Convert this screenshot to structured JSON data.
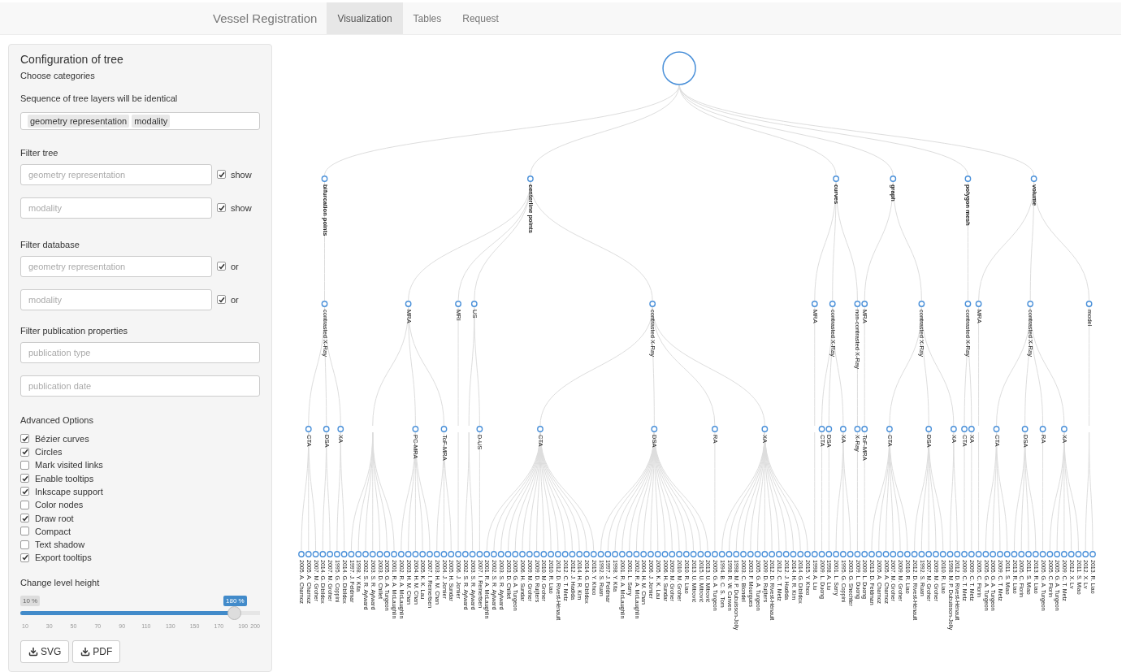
{
  "navbar": {
    "brand": "Vessel Registration",
    "tabs": [
      {
        "label": "Visualization",
        "selected": true
      },
      {
        "label": "Tables",
        "selected": false
      },
      {
        "label": "Request",
        "selected": false
      }
    ]
  },
  "sidebar": {
    "title": "Configuration of tree",
    "choose_label": "Choose categories",
    "sequence_label": "Sequence of tree layers will be identical",
    "sequence_tags": [
      "geometry representation",
      "modality"
    ],
    "filter_tree": {
      "label": "Filter tree",
      "rows": [
        {
          "placeholder": "geometry representation",
          "checked": true,
          "option": "show"
        },
        {
          "placeholder": "modality",
          "checked": true,
          "option": "show"
        }
      ]
    },
    "filter_database": {
      "label": "Filter database",
      "rows": [
        {
          "placeholder": "geometry representation",
          "checked": true,
          "option": "or"
        },
        {
          "placeholder": "modality",
          "checked": true,
          "option": "or"
        }
      ]
    },
    "filter_publication": {
      "label": "Filter publication properties",
      "fields": [
        {
          "placeholder": "publication type"
        },
        {
          "placeholder": "publication date"
        }
      ]
    },
    "advanced": {
      "label": "Advanced Options",
      "options": [
        {
          "label": "Bézier curves",
          "checked": true
        },
        {
          "label": "Circles",
          "checked": true
        },
        {
          "label": "Mark visited links",
          "checked": false
        },
        {
          "label": "Enable tooltips",
          "checked": true
        },
        {
          "label": "Inkscape support",
          "checked": true
        },
        {
          "label": "Color nodes",
          "checked": false
        },
        {
          "label": "Draw root",
          "checked": true
        },
        {
          "label": "Compact",
          "checked": false
        },
        {
          "label": "Text shadow",
          "checked": false
        },
        {
          "label": "Export tooltips",
          "checked": true
        }
      ]
    },
    "level_height": {
      "label": "Change level height",
      "min_label": "10 %",
      "value_label": "180 %",
      "level": 0.895,
      "ticks": [
        "10",
        "30",
        "50",
        "70",
        "90",
        "110",
        "130",
        "150",
        "170",
        "190",
        "200"
      ]
    },
    "buttons": [
      "SVG",
      "PDF"
    ]
  },
  "tree": {
    "children": [
      {
        "label": "bifurcation points",
        "children": [
          {
            "label": "contrasted X-Ray",
            "children": [
              {
                "label": "CTA",
                "children": [
                  {
                    "label": "2005. A. Charnoz"
                  },
                  {
                    "label": "2005. A. Charnoz"
                  },
                  {
                    "label": "2007. M. Groher"
                  }
                ]
              },
              {
                "label": "DSA",
                "children": [
                  {
                    "label": "2014. G. Dibildox"
                  },
                  {
                    "label": "2007. M. Groher"
                  }
                ]
              },
              {
                "label": "XA",
                "children": [
                  {
                    "label": "1995. G. Coppini"
                  },
                  {
                    "label": "2014. G. Dibildox"
                  }
                ]
              }
            ]
          }
        ]
      },
      {
        "label": "centerline points",
        "children": [
          {
            "label": "MRA",
            "children": [
              {
                "children": [
                  {
                    "label": "1997. J. Feldmar"
                  },
                  {
                    "label": "1998. Y. Kita"
                  },
                  {
                    "label": "2002. S. R. Aylward"
                  },
                  {
                    "label": "2003. S. R. Aylward"
                  },
                  {
                    "label": "2003. D. Chillet"
                  },
                  {
                    "label": "2005. G. A. Turgeon"
                  },
                  {
                    "label": "2001. R. A. McLaughlin"
                  }
                ]
              },
              {
                "label": "PC-MRA",
                "children": [
                  {
                    "label": "2002. R. A. McLaughlin"
                  },
                  {
                    "label": "2003. H. M. Chan"
                  },
                  {
                    "label": "2004. H. M. Chan"
                  },
                  {
                    "label": "2005. K. K. Lau"
                  },
                  {
                    "label": "2007. I. Reinertsen"
                  }
                ]
              },
              {
                "label": "ToF-MRA",
                "children": [
                  {
                    "label": "2003. H. M. Chan"
                  },
                  {
                    "label": "2004. J. Jomier"
                  },
                  {
                    "label": "2005. H. Sundar"
                  }
                ]
              }
            ]
          },
          {
            "label": "MRI",
            "children": [
              {
                "children": [
                  {
                    "label": "2006. J. Jomier"
                  }
                ]
              }
            ]
          },
          {
            "label": "US",
            "children": [
              {
                "children": [
                  {
                    "label": "2002. S. R. Aylward"
                  },
                  {
                    "label": "2003. S. R. Aylward"
                  }
                ]
              },
              {
                "label": "D-US",
                "children": [
                  {
                    "label": "2007. I. Reinertsen"
                  }
                ]
              }
            ]
          },
          {
            "label": "contrasted X-Ray",
            "children": [
              {
                "label": "CTA",
                "children": [
                  {
                    "label": "2001. R. A. McLaughlin"
                  },
                  {
                    "label": "2002. S. R. Aylward"
                  },
                  {
                    "label": "2003. S. R. Aylward"
                  },
                  {
                    "label": "2003. D. Chillet"
                  },
                  {
                    "label": "2005. G. A. Turgeon"
                  },
                  {
                    "label": "2006. H. Sundar"
                  },
                  {
                    "label": "2009. M. Groher"
                  },
                  {
                    "label": "2009. D. Ruijters"
                  },
                  {
                    "label": "2010. M. Groher"
                  },
                  {
                    "label": "2010. R. Liao"
                  },
                  {
                    "label": "2012. D. Rivest-Hénault"
                  },
                  {
                    "label": "2012. C. T. Metz"
                  },
                  {
                    "label": "2012. J. Hadida"
                  },
                  {
                    "label": "2014. H. R. Kim"
                  },
                  {
                    "label": "2014. G. Dibildox"
                  },
                  {
                    "label": "2015. Y. Khoo"
                  }
                ]
              },
              {
                "label": "DSA",
                "children": [
                  {
                    "label": "1992. S. Ruan"
                  },
                  {
                    "label": "1997. J. Feldmar"
                  },
                  {
                    "label": "1998. Y. Kita"
                  },
                  {
                    "label": "2001. R. A. McLaughlin"
                  },
                  {
                    "label": "2001. L. Sarry"
                  },
                  {
                    "label": "2002. R. A. McLaughlin"
                  },
                  {
                    "label": "2004. H. M. Chan"
                  },
                  {
                    "label": "2006. J. Jomier"
                  },
                  {
                    "label": "2005. K. K. Lau"
                  },
                  {
                    "label": "2006. H. Sundar"
                  },
                  {
                    "label": "2009. M. Groher"
                  },
                  {
                    "label": "2010. M. Groher"
                  },
                  {
                    "label": "2010. R. Liao"
                  },
                  {
                    "label": "2013. U. Mitrović"
                  },
                  {
                    "label": "2015. U. Mitrović"
                  },
                  {
                    "label": "2013. U. Mitrović"
                  }
                ]
              },
              {
                "label": "RA",
                "children": [
                  {
                    "label": "2005. G. A. Turgeon"
                  }
                ]
              },
              {
                "label": "XA",
                "children": [
                  {
                    "label": "1994. B. C. S. Tom"
                  },
                  {
                    "label": "1998. R. W. Curwen"
                  },
                  {
                    "label": "1998. M. P. Dubuisson-Jolly"
                  },
                  {
                    "label": "2003. C. Blondel"
                  },
                  {
                    "label": "2003. F. Mourgues"
                  },
                  {
                    "label": "2005. G. A. Turgeon"
                  },
                  {
                    "label": "2009. D. Ruijters"
                  },
                  {
                    "label": "2012. D. Rivest-Hénault"
                  },
                  {
                    "label": "2012. C. T. Metz"
                  },
                  {
                    "label": "2012. J. Hadida"
                  },
                  {
                    "label": "2014. H. R. Kim"
                  },
                  {
                    "label": "2014. G. Dibildox"
                  },
                  {
                    "label": "2015. Y. Khoo"
                  }
                ]
              }
            ]
          }
        ]
      },
      {
        "label": "curves",
        "children": [
          {
            "label": "MRA",
            "children": [
              {
                "children": [
                  {
                    "label": "1998. A. Liu"
                  }
                ]
              }
            ]
          },
          {
            "label": "contrasted X-Ray",
            "children": [
              {
                "label": "CTA",
                "children": [
                  {
                    "label": "2009. L. Duong"
                  }
                ]
              },
              {
                "label": "DSA",
                "children": [
                  {
                    "label": "1998. A. Liu"
                  }
                ]
              },
              {
                "label": "XA",
                "children": [
                  {
                    "label": "2001. L. Sarry"
                  },
                  {
                    "label": "1995. G. Coppini"
                  },
                  {
                    "label": "2003. G. Shechter"
                  }
                ]
              }
            ]
          },
          {
            "label": "non-contrasted X-Ray",
            "children": [
              {
                "label": "X-Ray",
                "children": [
                  {
                    "label": "2009. L. Duong"
                  }
                ]
              }
            ]
          }
        ]
      },
      {
        "label": "graph",
        "children": [
          {
            "label": "MRA",
            "children": [
              {
                "label": "ToF-MRA",
                "children": [
                  {
                    "label": "2009. L. Duong"
                  }
                ]
              }
            ]
          },
          {
            "label": "contrasted X-Ray",
            "children": [
              {
                "label": "CTA",
                "children": [
                  {
                    "label": "2013. D. Feldman"
                  },
                  {
                    "label": "2005. A. Charnoz"
                  },
                  {
                    "label": "2005. A. Charnoz"
                  },
                  {
                    "label": "2007. M. Groher"
                  },
                  {
                    "label": "2009. M. Groher"
                  },
                  {
                    "label": "2010. R. Liao"
                  }
                ]
              },
              {
                "label": "DSA",
                "children": [
                  {
                    "label": "2012. D. Rivest-Hénault"
                  },
                  {
                    "label": "1992. S. Ruan"
                  },
                  {
                    "label": "2007. M. Groher"
                  },
                  {
                    "label": "2009. M. Groher"
                  },
                  {
                    "label": "2010. R. Liao"
                  }
                ]
              },
              {
                "label": "XA",
                "children": [
                  {
                    "label": "1998. M. P. Dubuisson-Jolly"
                  },
                  {
                    "label": "2012. D. Rivest-Hénault"
                  }
                ]
              }
            ]
          }
        ]
      },
      {
        "label": "polygon mesh",
        "children": [
          {
            "label": "contrasted X-Ray",
            "children": [
              {
                "label": "CTA",
                "children": [
                  {
                    "label": "2009. C. T. Metz"
                  }
                ]
              },
              {
                "label": "XA",
                "children": [
                  {
                    "label": "2009. C. T. Metz"
                  }
                ]
              }
            ]
          }
        ]
      },
      {
        "label": "volume",
        "children": [
          {
            "label": "MRA",
            "children": [
              {
                "children": [
                  {
                    "label": "2005. C. Florin"
                  }
                ]
              }
            ]
          },
          {
            "label": "contrasted X-Ray",
            "children": [
              {
                "label": "CTA",
                "children": [
                  {
                    "label": "2005. G. A. Turgeon"
                  },
                  {
                    "label": "2005. G. A. Turgeon"
                  },
                  {
                    "label": "2009. C. T. Metz"
                  },
                  {
                    "label": "2011. S. Miao"
                  }
                ]
              },
              {
                "label": "DSA",
                "children": [
                  {
                    "label": "2013. R. Liao"
                  },
                  {
                    "label": "2005. C. Florin"
                  },
                  {
                    "label": "2011. S. Miao"
                  },
                  {
                    "label": "2013. R. Liao"
                  }
                ]
              },
              {
                "label": "RA",
                "children": [
                  {
                    "label": "2005. G. A. Turgeon"
                  }
                ]
              },
              {
                "label": "XA",
                "children": [
                  {
                    "label": "2005. C. Florin"
                  },
                  {
                    "label": "2005. G. A. Turgeon"
                  },
                  {
                    "label": "2009. C. T. Metz"
                  },
                  {
                    "label": "2012. X. Lv"
                  },
                  {
                    "label": "2011. S. Miao"
                  }
                ]
              }
            ]
          },
          {
            "label": "model",
            "children": [
              {
                "children": [
                  {
                    "label": "2012. X. Lv"
                  },
                  {
                    "label": "2013. R. Liao"
                  }
                ]
              }
            ]
          }
        ]
      }
    ]
  }
}
